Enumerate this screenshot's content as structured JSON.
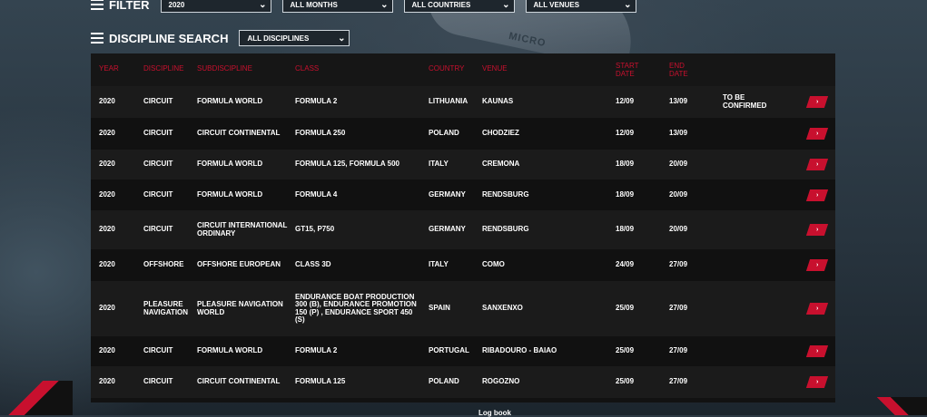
{
  "filter": {
    "title": "FILTER",
    "year": "2020",
    "months": "ALL MONTHS",
    "countries": "ALL COUNTRIES",
    "venues": "ALL VENUES"
  },
  "discipline_search": {
    "title": "DISCIPLINE SEARCH",
    "discipline": "ALL DISCIPLINES"
  },
  "boat_text": "MICRO",
  "table": {
    "headers": {
      "year": "YEAR",
      "discipline": "DISCIPLINE",
      "subdiscipline": "SUBDISCIPLINE",
      "class": "CLASS",
      "country": "COUNTRY",
      "venue": "VENUE",
      "start_date": "START DATE",
      "end_date": "END DATE"
    },
    "rows": [
      {
        "year": "2020",
        "discipline": "CIRCUIT",
        "subdiscipline": "FORMULA WORLD",
        "class": "FORMULA 2",
        "country": "LITHUANIA",
        "venue": "KAUNAS",
        "start": "12/09",
        "end": "13/09",
        "note": "TO BE CONFIRMED"
      },
      {
        "year": "2020",
        "discipline": "CIRCUIT",
        "subdiscipline": "CIRCUIT CONTINENTAL",
        "class": "FORMULA 250",
        "country": "POLAND",
        "venue": "CHODZIEZ",
        "start": "12/09",
        "end": "13/09",
        "note": ""
      },
      {
        "year": "2020",
        "discipline": "CIRCUIT",
        "subdiscipline": "FORMULA WORLD",
        "class": "FORMULA 125, FORMULA 500",
        "country": "ITALY",
        "venue": "CREMONA",
        "start": "18/09",
        "end": "20/09",
        "note": ""
      },
      {
        "year": "2020",
        "discipline": "CIRCUIT",
        "subdiscipline": "FORMULA WORLD",
        "class": "FORMULA 4",
        "country": "GERMANY",
        "venue": "RENDSBURG",
        "start": "18/09",
        "end": "20/09",
        "note": ""
      },
      {
        "year": "2020",
        "discipline": "CIRCUIT",
        "subdiscipline": "CIRCUIT INTERNATIONAL ORDINARY",
        "class": "GT15, P750",
        "country": "GERMANY",
        "venue": "RENDSBURG",
        "start": "18/09",
        "end": "20/09",
        "note": ""
      },
      {
        "year": "2020",
        "discipline": "OFFSHORE",
        "subdiscipline": "OFFSHORE EUROPEAN",
        "class": "CLASS 3D",
        "country": "ITALY",
        "venue": "COMO",
        "start": "24/09",
        "end": "27/09",
        "note": ""
      },
      {
        "year": "2020",
        "discipline": "PLEASURE NAVIGATION",
        "subdiscipline": "PLEASURE NAVIGATION WORLD",
        "class": "ENDURANCE BOAT PRODUCTION 300 (B), ENDURANCE PROMOTION 150 (P) , ENDURANCE SPORT 450 (S)",
        "country": "SPAIN",
        "venue": "SANXENXO",
        "start": "25/09",
        "end": "27/09",
        "note": ""
      },
      {
        "year": "2020",
        "discipline": "CIRCUIT",
        "subdiscipline": "FORMULA WORLD",
        "class": "FORMULA 2",
        "country": "PORTUGAL",
        "venue": "RIBADOURO - BAIAO",
        "start": "25/09",
        "end": "27/09",
        "note": ""
      },
      {
        "year": "2020",
        "discipline": "CIRCUIT",
        "subdiscipline": "CIRCUIT CONTINENTAL",
        "class": "FORMULA 125",
        "country": "POLAND",
        "venue": "ROGOZNO",
        "start": "25/09",
        "end": "27/09",
        "note": ""
      }
    ],
    "arrow_icon": "›"
  },
  "footer": {
    "log_book": "Log book"
  },
  "colors": {
    "accent": "#c8102e",
    "table_bg": "#121212",
    "row_alt": "#1b1b1b"
  }
}
